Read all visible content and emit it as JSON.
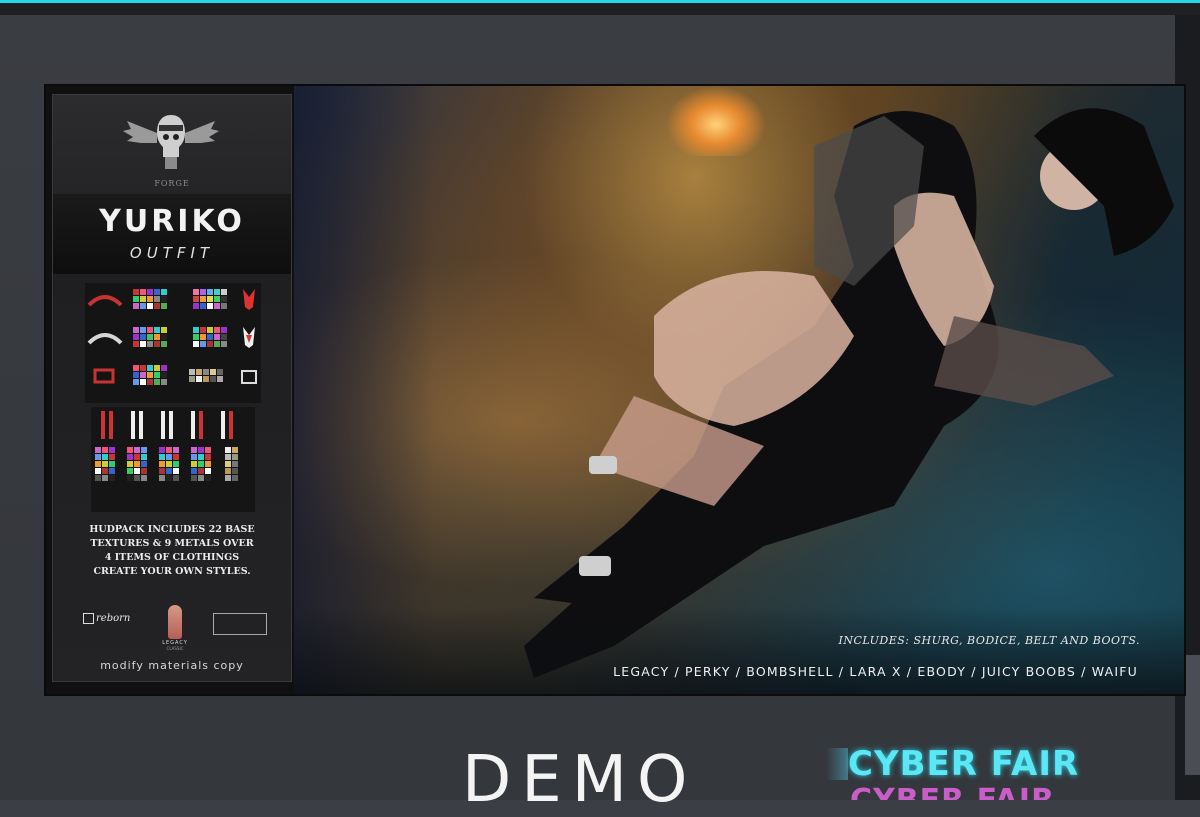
{
  "card": {
    "brand": "FORGE",
    "title": "YURIKO",
    "subtitle": "OUTFIT",
    "description": [
      "HUDPACK INCLUDES 22 BASE",
      "TEXTURES & 9 METALS OVER",
      "4 ITEMS OF CLOTHINGS",
      "CREATE YOUR OWN STYLES."
    ],
    "logos": {
      "reborn": "reborn",
      "legacy": "LEGACY",
      "legacy_sub": "CLASSIC"
    },
    "footer": "modify materials copy"
  },
  "scene": {
    "includes": "INCLUDES: SHURG, BODICE, BELT AND BOOTS.",
    "bodies": "LEGACY  / PERKY / BOMBSHELL / LARA X / EBODY / JUICY BOOBS / WAIFU"
  },
  "footer_sign": {
    "demo": "DEMO",
    "event": "CYBER FAIR"
  },
  "colors": {
    "accent_cyan": "#28d8e6",
    "event_cyan": "#5be8f4",
    "event_magenta": "#c95ec9",
    "frame": "#3a3d42"
  },
  "icons": {
    "emblem": "winged-skull-emblem",
    "palette": "texture-swatch-grid"
  }
}
